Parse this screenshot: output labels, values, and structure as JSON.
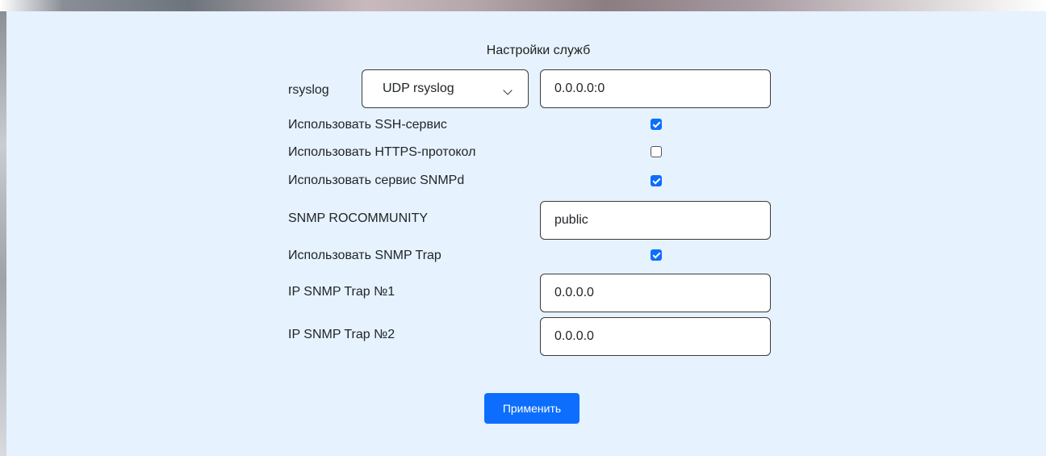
{
  "form": {
    "title": "Настройки служб",
    "rsyslog": {
      "label": "rsyslog",
      "protocol_selected": "UDP rsyslog",
      "address_value": "0.0.0.0:0"
    },
    "ssh": {
      "label": "Использовать SSH-сервис",
      "checked": true
    },
    "https": {
      "label": "Использовать HTTPS-протокол",
      "checked": false
    },
    "snmpd": {
      "label": "Использовать сервис SNMPd",
      "checked": true
    },
    "rocommunity": {
      "label": "SNMP ROCOMMUNITY",
      "value": "public"
    },
    "snmp_trap": {
      "label": "Использовать SNMP Trap",
      "checked": true
    },
    "trap1": {
      "label": "IP SNMP Trap №1",
      "value": "0.0.0.0"
    },
    "trap2": {
      "label": "IP SNMP Trap №2",
      "value": "0.0.0.0"
    },
    "apply_label": "Применить"
  },
  "colors": {
    "panel_bg": "#e6f2fd",
    "accent": "#0d6efd"
  }
}
